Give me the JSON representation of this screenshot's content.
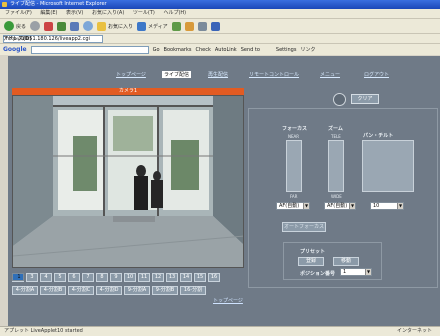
{
  "browser": {
    "title": "ライブ配信 - Microsoft Internet Explorer",
    "menu": [
      "ファイル(F)",
      "編集(E)",
      "表示(V)",
      "お気に入り(A)",
      "ツール(T)",
      "ヘルプ(H)"
    ],
    "toolbar": {
      "back": "戻る",
      "favorites": "お気に入り",
      "media": "メディア",
      "links": "リンク"
    },
    "address_label": "アドレス(D)",
    "address": "http://10.51.180.126/liveapp2.cgi",
    "google": {
      "logo": "Google",
      "go": "Go",
      "bookmarks": "Bookmarks",
      "check": "Check",
      "autolink": "AutoLink",
      "sendto": "Send to",
      "settings": "Settings",
      "link": "リンク"
    },
    "status_left": "アプレット LiveApplet10 started",
    "status_right": "インターネット"
  },
  "nav": {
    "items": [
      {
        "label": "トップページ",
        "active": false
      },
      {
        "label": "ライブ配信",
        "active": true
      },
      {
        "label": "再生配信",
        "active": false
      },
      {
        "label": "リモートコントロール",
        "active": false
      },
      {
        "label": "メニュー",
        "active": false
      },
      {
        "label": "ログアウト",
        "active": false
      }
    ]
  },
  "camera": {
    "header": "カメラ1",
    "numbers": [
      "1",
      "2",
      "3",
      "4",
      "5",
      "6",
      "7",
      "8",
      "9",
      "10",
      "11",
      "12",
      "13",
      "14",
      "15",
      "16"
    ],
    "selected": "1",
    "presets": [
      "4-分割A",
      "4-分割B",
      "4-分割C",
      "4-分割D",
      "9-分割A",
      "9-分割B",
      "16-分割"
    ],
    "top_link": "トップページ"
  },
  "ptz": {
    "clear": "クリア",
    "focus": {
      "label": "フォーカス",
      "near": "NEAR",
      "far": "FAR",
      "mode": "AF(自動)"
    },
    "zoom": {
      "label": "ズーム",
      "tele": "TELE",
      "wide": "WIDE",
      "mode": "AF(自動)"
    },
    "pantilt": {
      "label": "パン・チルト",
      "speed": "10"
    },
    "autofocus": "オートフォーカス",
    "preset": {
      "label": "プリセット",
      "register": "登録",
      "move": "移動",
      "number_label": "ポジション番号",
      "number": "1"
    }
  },
  "colors": {
    "accent": "#e25b22",
    "page_bg": "#6f7a87",
    "button": "#8b9aa8",
    "selected": "#2f6fb8"
  }
}
